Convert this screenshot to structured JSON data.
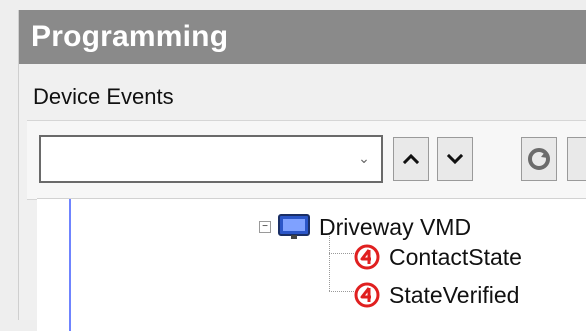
{
  "panel": {
    "title": "Programming",
    "section_label": "Device Events"
  },
  "toolbar": {
    "search_input_value": "",
    "buttons": [
      {
        "name": "up-button",
        "icon": "chevron-up-icon"
      },
      {
        "name": "down-button",
        "icon": "chevron-down-icon"
      },
      {
        "name": "refresh-button",
        "icon": "refresh-icon"
      }
    ]
  },
  "tree": {
    "nodes": [
      {
        "label": "Driveway VMD",
        "icon": "monitor-icon",
        "expanded": true,
        "level": 1
      },
      {
        "label": "ContactState",
        "icon": "event-4-icon",
        "level": 2
      },
      {
        "label": "StateVerified",
        "icon": "event-4-icon",
        "level": 2
      }
    ]
  },
  "colors": {
    "title_bg": "#8a8a8a",
    "tree_line": "#6f84ff",
    "event_red": "#e02020"
  }
}
